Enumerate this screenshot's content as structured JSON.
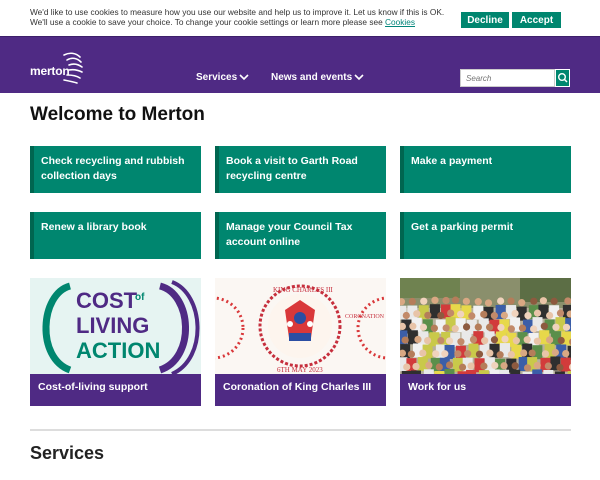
{
  "cookie": {
    "text": "We'd like to use cookies to measure how you use our website and help us to improve it. Let us know if this is OK. We'll use a cookie to save your choice. To change your cookie settings or learn more please see",
    "link": "Cookies",
    "decline": "Decline",
    "accept": "Accept"
  },
  "header": {
    "logo_text": "merton",
    "nav": [
      "Services",
      "News and events"
    ],
    "search_placeholder": "Search"
  },
  "main": {
    "title": "Welcome to Merton",
    "tiles": [
      "Check recycling and rubbish collection days",
      "Book a visit to Garth Road recycling centre",
      "Make a payment",
      "Renew a library book",
      "Manage your Council Tax account online",
      "Get a parking permit"
    ],
    "cards": [
      {
        "label": "Cost-of-living support",
        "image_text": [
          "COST",
          "of",
          "LIVING",
          "ACTION"
        ]
      },
      {
        "label": "Coronation of King Charles III",
        "image_text": [
          "KING CHARLES III",
          "CORONATION",
          "6TH MAY 2023"
        ]
      },
      {
        "label": "Work for us"
      }
    ],
    "section_title": "Services"
  },
  "colors": {
    "purple": "#4f2a84",
    "green": "#00866f",
    "dark_green": "#006650"
  }
}
